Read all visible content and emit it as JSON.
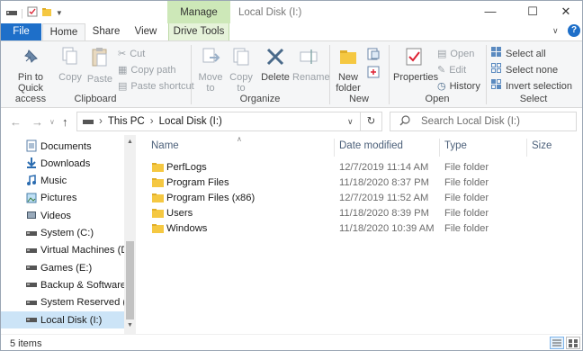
{
  "titlebar": {
    "manage": "Manage",
    "title": "Local Disk (I:)",
    "minimize": "—",
    "maximize": "☐",
    "close": "✕"
  },
  "tabs": [
    "File",
    "Home",
    "Share",
    "View",
    "Drive Tools"
  ],
  "ribbon": {
    "clipboard": {
      "pin": "Pin to Quick access",
      "copy": "Copy",
      "paste": "Paste",
      "cut": "Cut",
      "copy_path": "Copy path",
      "paste_shortcut": "Paste shortcut",
      "label": "Clipboard"
    },
    "organize": {
      "move_to": "Move to",
      "copy_to": "Copy to",
      "delete": "Delete",
      "rename": "Rename",
      "label": "Organize"
    },
    "new": {
      "new_folder": "New folder",
      "label": "New"
    },
    "open": {
      "properties": "Properties",
      "open": "Open",
      "edit": "Edit",
      "history": "History",
      "label": "Open"
    },
    "select": {
      "select_all": "Select all",
      "select_none": "Select none",
      "invert": "Invert selection",
      "label": "Select"
    }
  },
  "address": {
    "path": [
      "This PC",
      "Local Disk (I:)"
    ],
    "search_placeholder": "Search Local Disk (I:)"
  },
  "nav": [
    {
      "label": "Documents",
      "icon": "documents-icon"
    },
    {
      "label": "Downloads",
      "icon": "downloads-icon"
    },
    {
      "label": "Music",
      "icon": "music-icon"
    },
    {
      "label": "Pictures",
      "icon": "pictures-icon"
    },
    {
      "label": "Videos",
      "icon": "videos-icon"
    },
    {
      "label": "System (C:)",
      "icon": "drive-icon"
    },
    {
      "label": "Virtual Machines (D:)",
      "icon": "drive-icon"
    },
    {
      "label": "Games (E:)",
      "icon": "drive-icon"
    },
    {
      "label": "Backup & Software (F:",
      "icon": "drive-icon"
    },
    {
      "label": "System Reserved (G:)",
      "icon": "drive-icon"
    },
    {
      "label": "Local Disk (I:)",
      "icon": "drive-icon"
    }
  ],
  "columns": {
    "name": "Name",
    "date": "Date modified",
    "type": "Type",
    "size": "Size"
  },
  "files": [
    {
      "name": "PerfLogs",
      "date": "12/7/2019 11:14 AM",
      "type": "File folder"
    },
    {
      "name": "Program Files",
      "date": "11/18/2020 8:37 PM",
      "type": "File folder"
    },
    {
      "name": "Program Files (x86)",
      "date": "12/7/2019 11:52 AM",
      "type": "File folder"
    },
    {
      "name": "Users",
      "date": "11/18/2020 8:39 PM",
      "type": "File folder"
    },
    {
      "name": "Windows",
      "date": "11/18/2020 10:39 AM",
      "type": "File folder"
    }
  ],
  "status": {
    "count": "5 items"
  },
  "colors": {
    "file_tab": "#1e6fc9",
    "manage_tab": "#cde8b8",
    "selected": "#cce4f7",
    "folder": "#f5c842"
  }
}
